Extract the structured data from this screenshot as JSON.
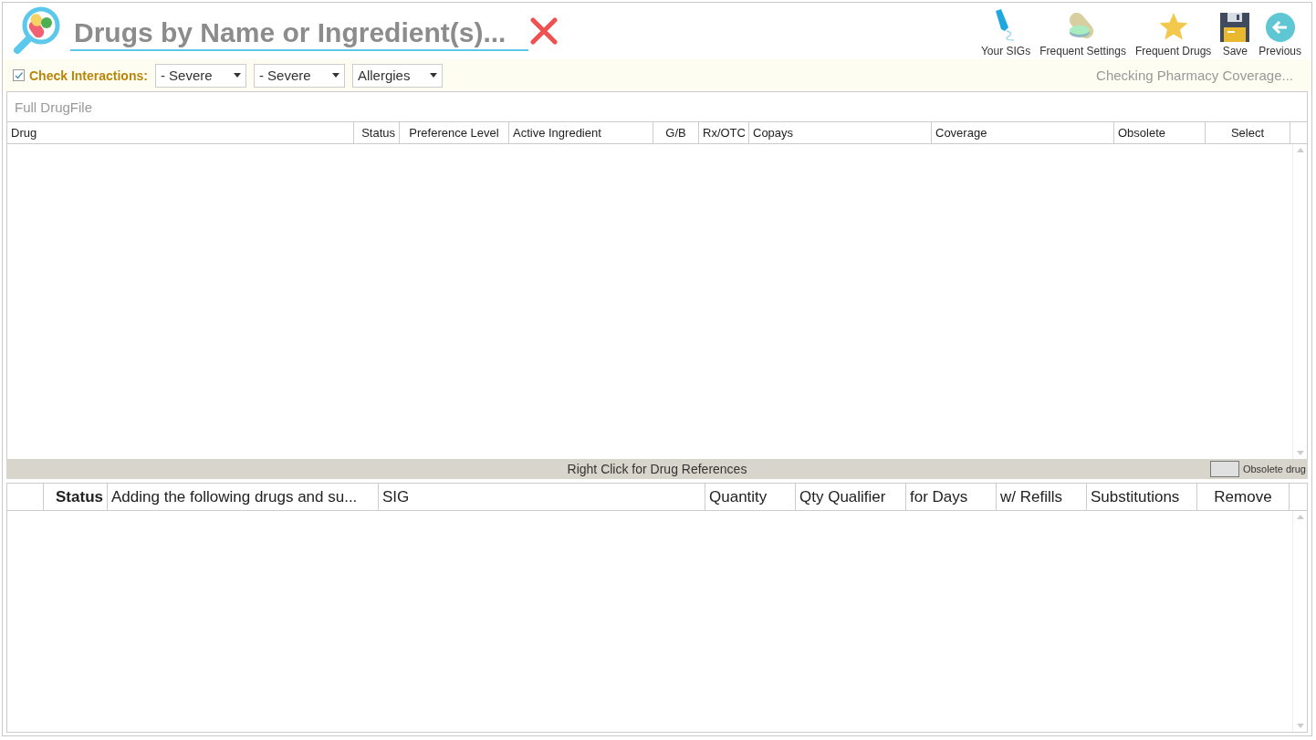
{
  "search": {
    "placeholder": "Drugs by Name or Ingredient(s)..."
  },
  "toolbar": [
    {
      "label": "Your SIGs",
      "kind": "pen"
    },
    {
      "label": "Frequent Settings",
      "kind": "pills"
    },
    {
      "label": "Frequent Drugs",
      "kind": "star"
    },
    {
      "label": "Save",
      "kind": "disk"
    },
    {
      "label": "Previous",
      "kind": "back"
    }
  ],
  "interactions": {
    "label": "Check Interactions:",
    "checked": true,
    "dropdowns": [
      "- Severe",
      "- Severe",
      "Allergies"
    ]
  },
  "coverage_status": "Checking Pharmacy Coverage...",
  "drug_file": {
    "title": "Full DrugFile",
    "columns": [
      "Drug",
      "Status",
      "Preference Level",
      "Active Ingredient",
      "G/B",
      "Rx/OTC",
      "Copays",
      "Coverage",
      "Obsolete",
      "Select"
    ]
  },
  "hint_bar": {
    "text": "Right Click for Drug References",
    "legend": "Obsolete drug"
  },
  "adding": {
    "columns": [
      {
        "label": "Status",
        "bold": true
      },
      {
        "label": "Adding the following drugs and su...",
        "bold": false
      },
      {
        "label": "SIG",
        "bold": false
      },
      {
        "label": "Quantity",
        "bold": false
      },
      {
        "label": "Qty Qualifier",
        "bold": false
      },
      {
        "label": "for Days",
        "bold": false
      },
      {
        "label": "w/ Refills",
        "bold": false
      },
      {
        "label": "Substitutions",
        "bold": false
      },
      {
        "label": "Remove",
        "bold": false
      }
    ]
  }
}
